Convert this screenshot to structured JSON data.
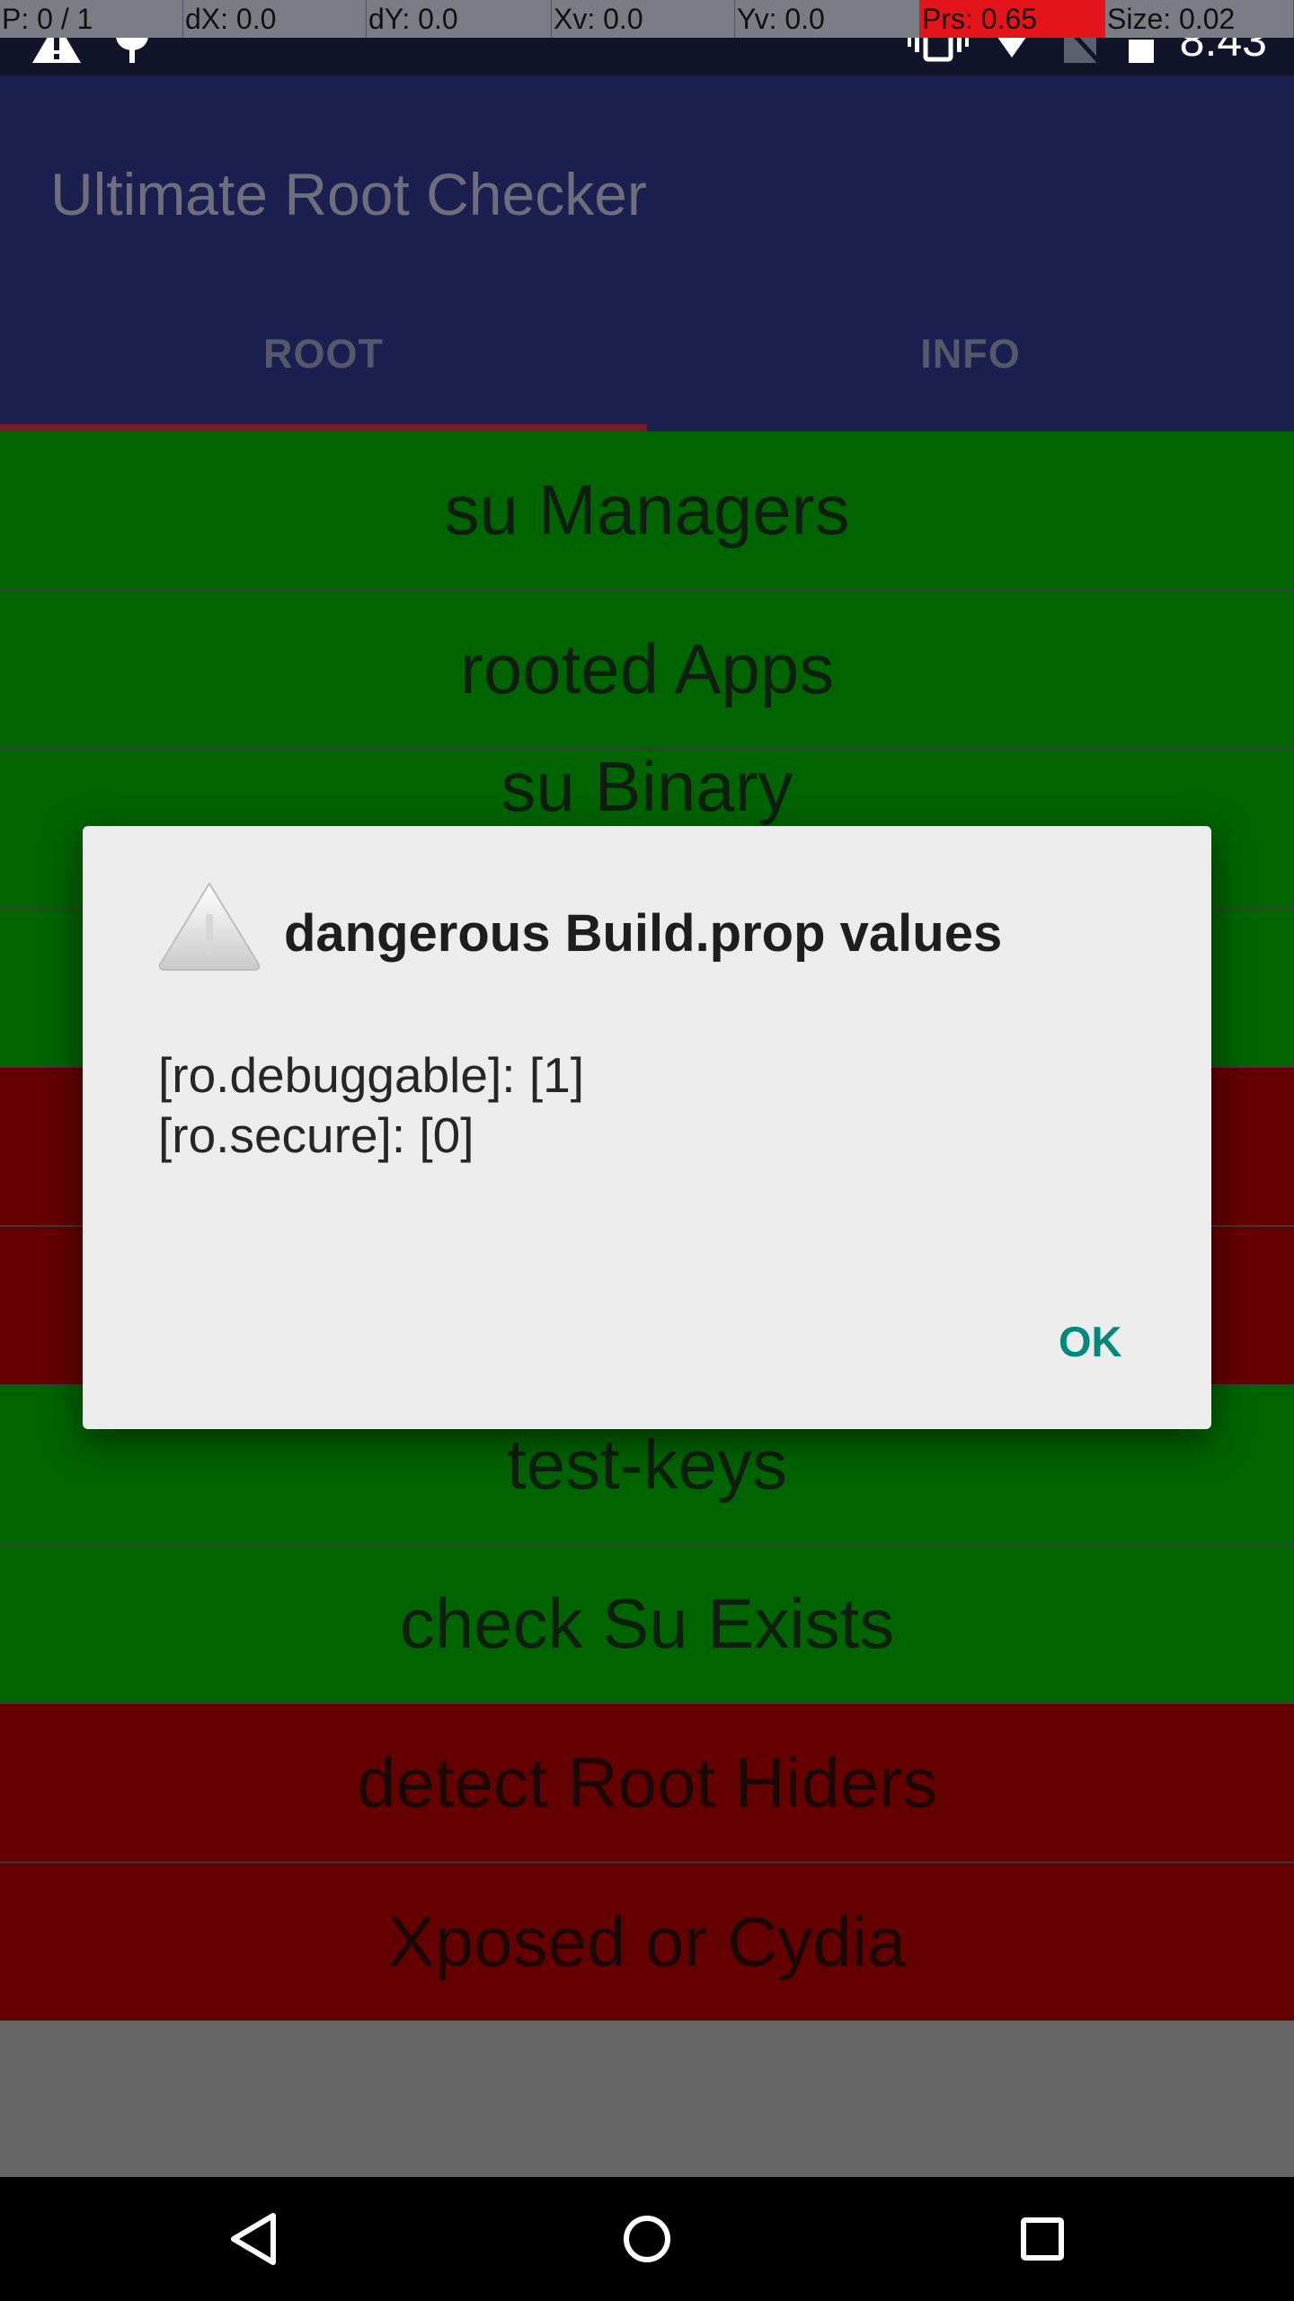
{
  "debug_bar": {
    "pointer": "P: 0 / 1",
    "dx": "dX: 0.0",
    "dy": "dY: 0.0",
    "xv": "Xv: 0.0",
    "yv": "Yv: 0.0",
    "prs": "Prs: 0.65",
    "size": "Size: 0.02"
  },
  "status_bar": {
    "time": "8:43",
    "icons": [
      "warning-icon",
      "android-debug-icon",
      "vibrate-icon",
      "wifi-icon",
      "no-sim-icon",
      "battery-icon"
    ]
  },
  "app_bar": {
    "title": "Ultimate Root Checker",
    "tabs": [
      {
        "label": "ROOT",
        "selected": true
      },
      {
        "label": "INFO",
        "selected": false
      }
    ]
  },
  "checks": [
    {
      "label": "su Managers",
      "status": "ok"
    },
    {
      "label": "rooted Apps",
      "status": "ok"
    },
    {
      "label": "su Binary",
      "status": "ok"
    },
    {
      "label": "",
      "status": "ok"
    },
    {
      "label": "",
      "status": "fail"
    },
    {
      "label": "",
      "status": "fail"
    },
    {
      "label": "test-keys",
      "status": "ok"
    },
    {
      "label": "check Su Exists",
      "status": "ok"
    },
    {
      "label": "detect Root Hiders",
      "status": "fail"
    },
    {
      "label": "Xposed or Cydia",
      "status": "fail"
    }
  ],
  "colors": {
    "ok_row": "#006400",
    "fail_row": "#640000",
    "app_bar": "#1c2050",
    "dialog_button": "#00897b"
  },
  "dialog": {
    "icon": "warning-icon",
    "title": "dangerous Build.prop values",
    "message_lines": [
      "[ro.debuggable]: [1]",
      "[ro.secure]: [0]"
    ],
    "ok_label": "OK"
  },
  "nav_bar": {
    "buttons": [
      "back-icon",
      "home-icon",
      "recents-icon"
    ]
  }
}
